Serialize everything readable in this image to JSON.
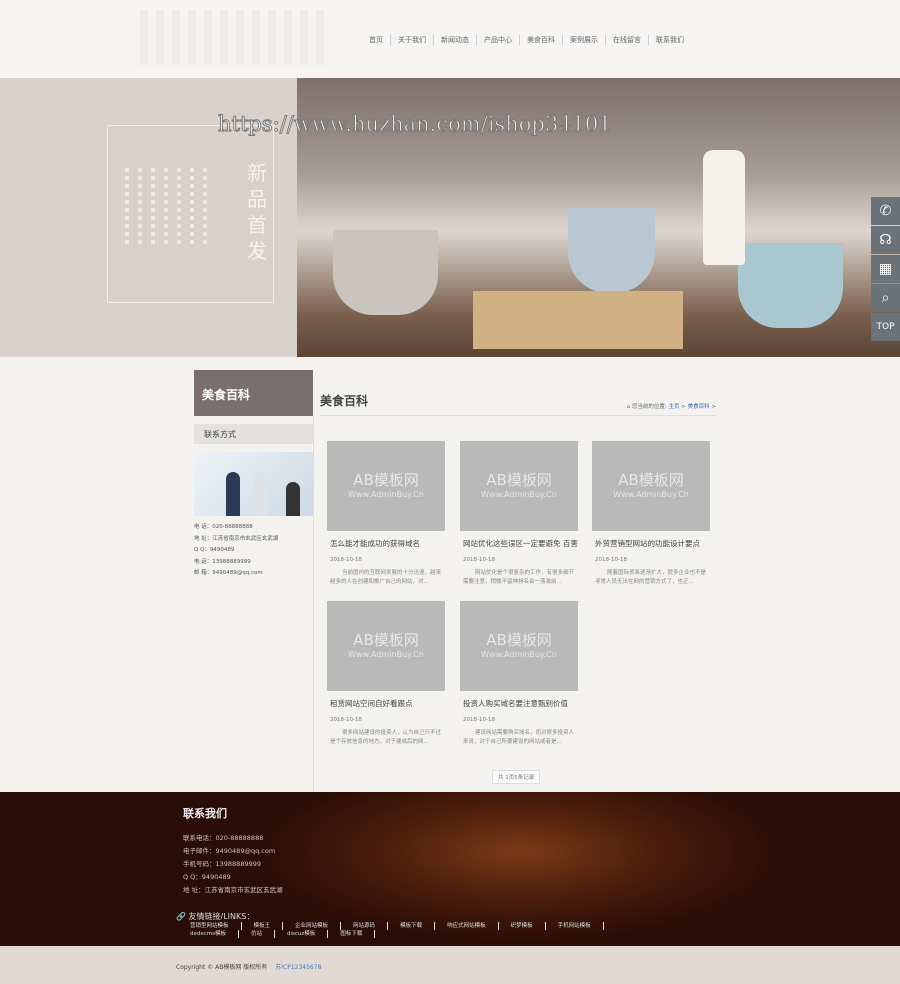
{
  "nav": [
    "首页",
    "关于我们",
    "新闻动态",
    "产品中心",
    "美食百科",
    "案例展示",
    "在线留言",
    "联系我们"
  ],
  "banner": {
    "title": "新品首发",
    "watermark": "https://www.huzhan.com/ishop34101"
  },
  "side_tools": [
    {
      "icon": "phone-icon",
      "glyph": "✆"
    },
    {
      "icon": "support-icon",
      "glyph": "☊"
    },
    {
      "icon": "qrcode-icon",
      "glyph": "▦"
    },
    {
      "icon": "search-icon",
      "glyph": "⌕"
    },
    {
      "icon": "top-icon",
      "glyph": "TOP"
    }
  ],
  "sidebar": {
    "title": "美食百科",
    "contact_label": "联系方式",
    "info": [
      "电 话：020-88888888",
      "地 址：江苏省南京市玄武区玄武湖",
      "Q Q：9490489",
      "电 话：13988889999",
      "邮 箱：9490489@qq.com"
    ]
  },
  "main": {
    "title": "美食百科",
    "breadcrumb": {
      "prefix": "您当前的位置:",
      "home": "主页",
      "current": "美食百科",
      "sep": ">"
    },
    "placeholder": {
      "line1": "AB模板网",
      "line2": "Www.AdminBuy.Cn"
    },
    "articles": [
      {
        "title": "怎么能才能成功的获得域名",
        "date": "2018-10-18",
        "summary": "当前国内的互联网发展的十分迅速，越来越多的人在创建和推广自己的网站，对..."
      },
      {
        "title": "网站优化这些误区一定要避免 百害",
        "date": "2018-10-18",
        "summary": "网站优化是个很复杂的工作，有很多细节需要注意，稍微不留神排名会一落激前..."
      },
      {
        "title": "外贸营销型网站的功能设计要点",
        "date": "2018-10-18",
        "summary": "随着国际贸易逐渐扩大，很多企业也不是寻常人员无法在网的营销方式了，也正..."
      },
      {
        "title": "租赁网站空间自好看跟点",
        "date": "2018-10-18",
        "summary": "很多网站建设的投资人，认为自己只不过是个存放信息的地方，对于建成后的网..."
      },
      {
        "title": "投资人购买域名要注意甄别价值",
        "date": "2018-10-18",
        "summary": "建设网站需要购买域名，而对很多投资人来说，对于自己所要建设的网站或者是..."
      }
    ],
    "pager": "共 1页5条记录"
  },
  "footer": {
    "title": "联系我们",
    "info": [
      "联系电话：020-88888888",
      "电子邮件：9490489@qq.com",
      "手机号码：13988889999",
      "Q Q：9490489",
      "地 址：江苏省南京市玄武区玄武湖"
    ],
    "links_title": "友情链接/LINKS：",
    "links": [
      [
        "营销型网站模板",
        "模板王",
        "企业网站模板",
        "网站源码",
        "模板下载",
        "响应式网站模板",
        "织梦模板",
        "手机网站模板"
      ],
      [
        "dedecms模板",
        "仿站",
        "discuz模板",
        "图标下载"
      ]
    ]
  },
  "bottom": {
    "copyright": "Copyright © AB模板网 版权所有",
    "icp": "苏ICP12345678"
  }
}
